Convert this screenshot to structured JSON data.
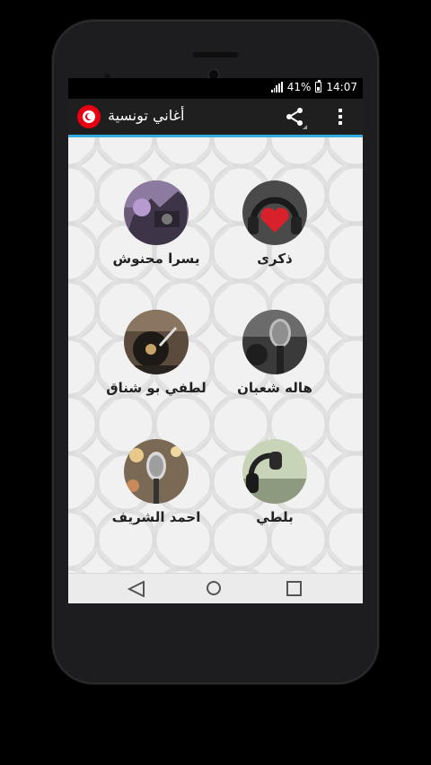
{
  "status_bar": {
    "battery_percent": "41%",
    "time": "14:07",
    "icons": [
      "signal-icon",
      "battery-icon"
    ]
  },
  "app_bar": {
    "title": "أغاني تونسية",
    "logo_icon": "tunisia-flag-icon",
    "share_icon": "share-icon",
    "overflow_icon": "overflow-menu-icon",
    "accent_color": "#35a9e0"
  },
  "artists": [
    {
      "name": "يسرا محنوش",
      "image": "music-studio-photo"
    },
    {
      "name": "ذكرى",
      "image": "headphones-heart-photo"
    },
    {
      "name": "لطفي بو شناق",
      "image": "turntable-photo"
    },
    {
      "name": "هاله شعبان",
      "image": "microphone-photo"
    },
    {
      "name": "احمد الشريف",
      "image": "vintage-microphone-photo"
    },
    {
      "name": "بلطي",
      "image": "headphones-photo"
    }
  ],
  "nav_bar": {
    "icons": [
      "back-icon",
      "home-icon",
      "recents-icon"
    ]
  }
}
